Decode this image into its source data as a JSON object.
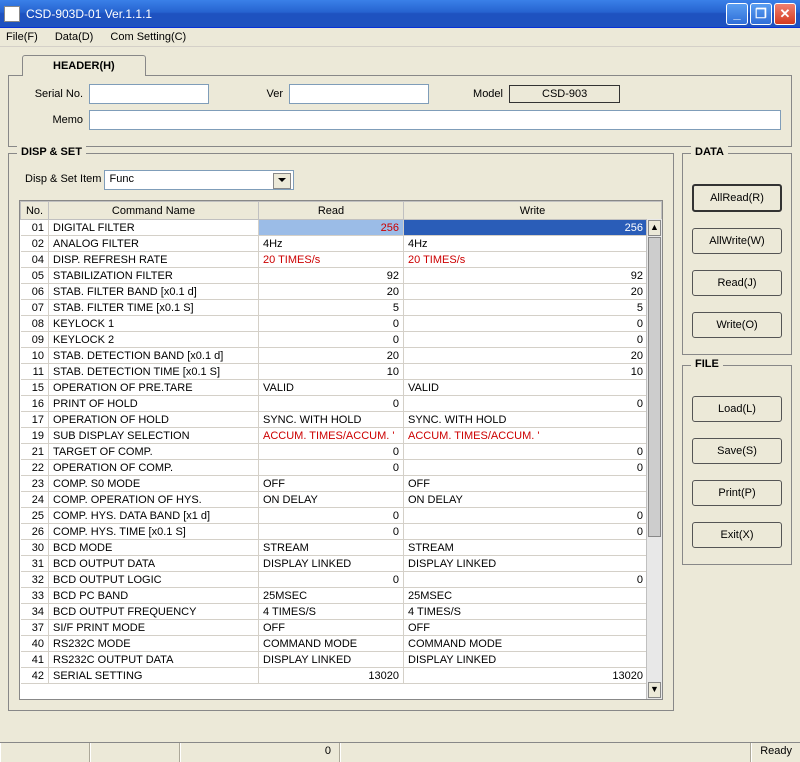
{
  "window": {
    "title": "CSD-903D-01 Ver.1.1.1"
  },
  "menu": {
    "file": "File(F)",
    "data": "Data(D)",
    "com": "Com Setting(C)"
  },
  "header": {
    "tab": "HEADER(H)",
    "serial_lbl": "Serial No.",
    "serial_val": "",
    "ver_lbl": "Ver",
    "ver_val": "",
    "model_lbl": "Model",
    "model_val": "CSD-903",
    "memo_lbl": "Memo",
    "memo_val": ""
  },
  "dispset": {
    "title": "DISP & SET",
    "item_lbl": "Disp & Set Item",
    "item_val": "Func",
    "cols": {
      "no": "No.",
      "cmd": "Command Name",
      "read": "Read",
      "write": "Write"
    },
    "rows": [
      {
        "no": "01",
        "cmd": "DIGITAL FILTER",
        "read": "256",
        "write": "256",
        "rred": true,
        "align": "r",
        "sel": true
      },
      {
        "no": "02",
        "cmd": "ANALOG FILTER",
        "read": "4Hz",
        "write": "4Hz"
      },
      {
        "no": "04",
        "cmd": "DISP. REFRESH RATE",
        "read": "20 TIMES/s",
        "write": "20 TIMES/s",
        "rred": true,
        "wred": true
      },
      {
        "no": "05",
        "cmd": "STABILIZATION FILTER",
        "read": "92",
        "write": "92",
        "align": "r"
      },
      {
        "no": "06",
        "cmd": "STAB. FILTER BAND [x0.1 d]",
        "read": "20",
        "write": "20",
        "align": "r"
      },
      {
        "no": "07",
        "cmd": "STAB. FILTER TIME [x0.1 S]",
        "read": "5",
        "write": "5",
        "align": "r"
      },
      {
        "no": "08",
        "cmd": "KEYLOCK 1",
        "read": "0",
        "write": "0",
        "align": "r"
      },
      {
        "no": "09",
        "cmd": "KEYLOCK 2",
        "read": "0",
        "write": "0",
        "align": "r"
      },
      {
        "no": "10",
        "cmd": "STAB. DETECTION BAND [x0.1 d]",
        "read": "20",
        "write": "20",
        "align": "r"
      },
      {
        "no": "11",
        "cmd": "STAB. DETECTION TIME [x0.1 S]",
        "read": "10",
        "write": "10",
        "align": "r"
      },
      {
        "no": "15",
        "cmd": "OPERATION OF PRE.TARE",
        "read": "VALID",
        "write": "VALID"
      },
      {
        "no": "16",
        "cmd": "PRINT OF HOLD",
        "read": "0",
        "write": "0",
        "align": "r"
      },
      {
        "no": "17",
        "cmd": "OPERATION OF HOLD",
        "read": "SYNC. WITH HOLD",
        "write": "SYNC. WITH HOLD"
      },
      {
        "no": "19",
        "cmd": "SUB DISPLAY SELECTION",
        "read": "ACCUM. TIMES/ACCUM. '",
        "write": "ACCUM. TIMES/ACCUM. '",
        "rred": true,
        "wred": true
      },
      {
        "no": "21",
        "cmd": "TARGET OF COMP.",
        "read": "0",
        "write": "0",
        "align": "r"
      },
      {
        "no": "22",
        "cmd": "OPERATION OF COMP.",
        "read": "0",
        "write": "0",
        "align": "r"
      },
      {
        "no": "23",
        "cmd": "COMP. S0 MODE",
        "read": "OFF",
        "write": "OFF"
      },
      {
        "no": "24",
        "cmd": "COMP. OPERATION OF HYS.",
        "read": "ON DELAY",
        "write": "ON DELAY"
      },
      {
        "no": "25",
        "cmd": "COMP. HYS. DATA BAND [x1 d]",
        "read": "0",
        "write": "0",
        "align": "r"
      },
      {
        "no": "26",
        "cmd": "COMP. HYS. TIME [x0.1 S]",
        "read": "0",
        "write": "0",
        "align": "r"
      },
      {
        "no": "30",
        "cmd": "BCD MODE",
        "read": "STREAM",
        "write": "STREAM"
      },
      {
        "no": "31",
        "cmd": "BCD OUTPUT DATA",
        "read": "DISPLAY LINKED",
        "write": "DISPLAY LINKED"
      },
      {
        "no": "32",
        "cmd": "BCD OUTPUT LOGIC",
        "read": "0",
        "write": "0",
        "align": "r"
      },
      {
        "no": "33",
        "cmd": "BCD PC BAND",
        "read": "25MSEC",
        "write": "25MSEC"
      },
      {
        "no": "34",
        "cmd": "BCD OUTPUT FREQUENCY",
        "read": "4 TIMES/S",
        "write": "4 TIMES/S"
      },
      {
        "no": "37",
        "cmd": "SI/F PRINT MODE",
        "read": "OFF",
        "write": "OFF"
      },
      {
        "no": "40",
        "cmd": "RS232C MODE",
        "read": "COMMAND MODE",
        "write": "COMMAND MODE"
      },
      {
        "no": "41",
        "cmd": "RS232C OUTPUT DATA",
        "read": "DISPLAY LINKED",
        "write": "DISPLAY LINKED"
      },
      {
        "no": "42",
        "cmd": "SERIAL SETTING",
        "read": "13020",
        "write": "13020",
        "align": "r"
      }
    ]
  },
  "side": {
    "data_title": "DATA",
    "allread": "AllRead(R)",
    "allwrite": "AllWrite(W)",
    "read": "Read(J)",
    "write": "Write(O)",
    "file_title": "FILE",
    "load": "Load(L)",
    "save": "Save(S)",
    "print": "Print(P)",
    "exit": "Exit(X)"
  },
  "status": {
    "center": "0",
    "right": "Ready"
  }
}
